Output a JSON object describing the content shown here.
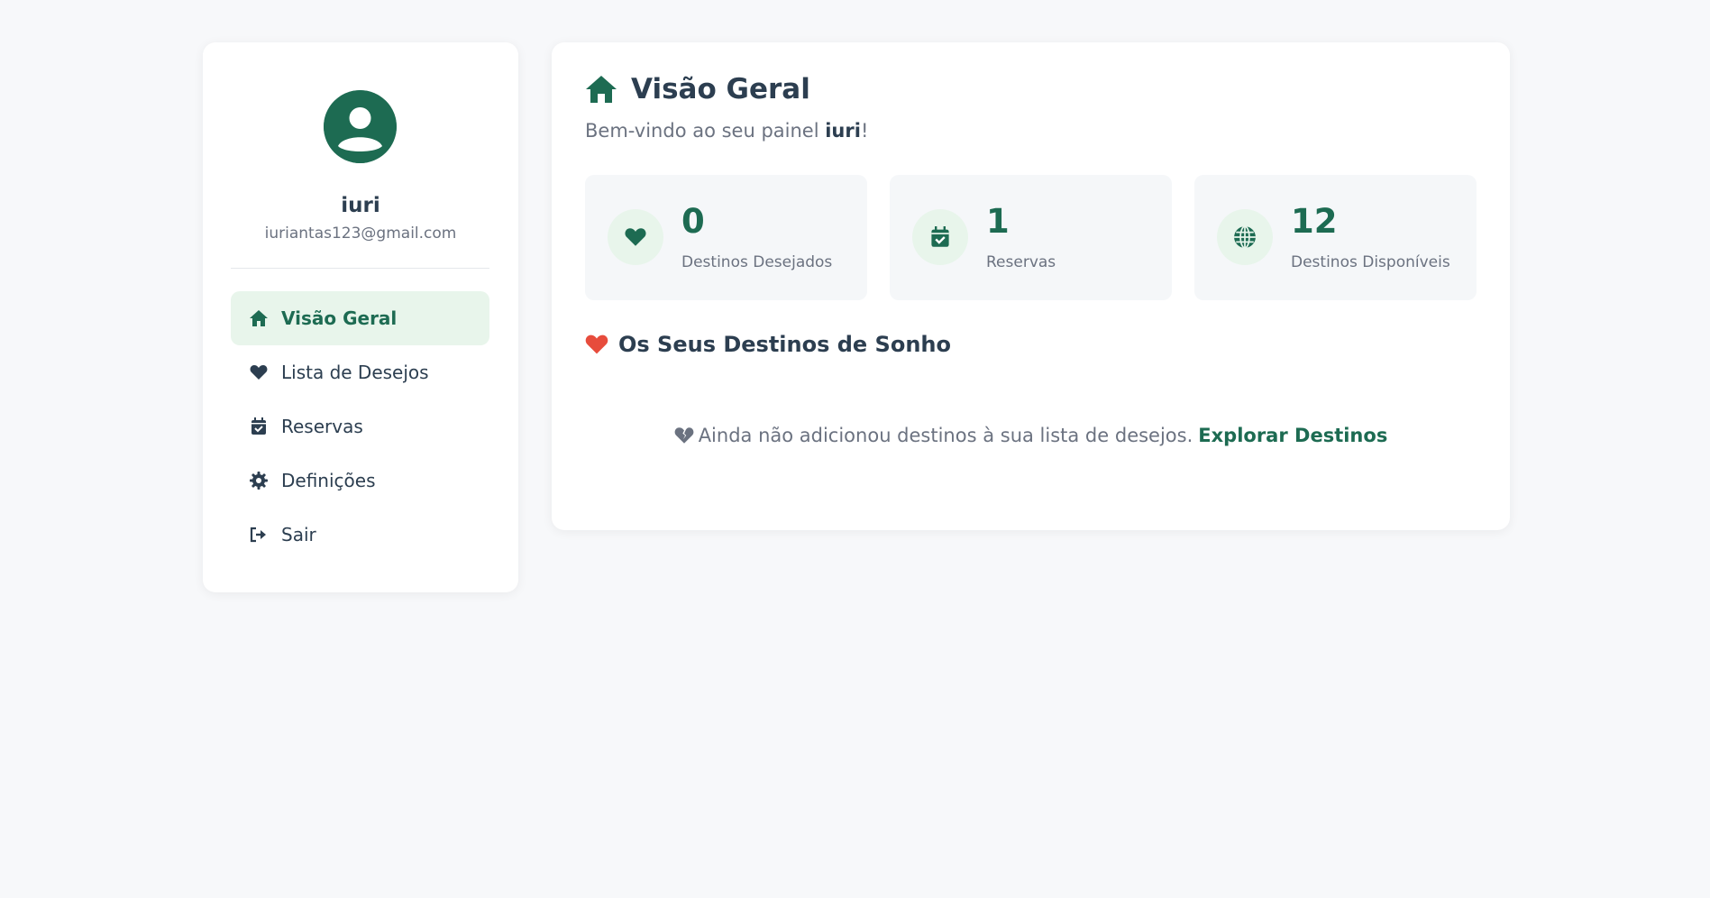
{
  "user": {
    "name": "iuri",
    "email": "iuriantas123@gmail.com"
  },
  "sidebar": {
    "items": [
      {
        "label": "Visão Geral",
        "icon": "home-icon",
        "active": true
      },
      {
        "label": "Lista de Desejos",
        "icon": "heart-icon"
      },
      {
        "label": "Reservas",
        "icon": "calendar-check-icon"
      },
      {
        "label": "Definições",
        "icon": "gear-icon"
      },
      {
        "label": "Sair",
        "icon": "logout-icon"
      }
    ]
  },
  "main": {
    "title": "Visão Geral",
    "welcome_prefix": "Bem-vindo ao seu painel ",
    "welcome_name": "iuri",
    "welcome_suffix": "!",
    "stats": [
      {
        "value": "0",
        "label": "Destinos Desejados",
        "icon": "heart-icon"
      },
      {
        "value": "1",
        "label": "Reservas",
        "icon": "calendar-check-icon"
      },
      {
        "value": "12",
        "label": "Destinos Disponíveis",
        "icon": "globe-icon"
      }
    ],
    "section_title": "Os Seus Destinos de Sonho",
    "empty_text": "Ainda não adicionou destinos à sua lista de desejos.",
    "explore_link": "Explorar Destinos"
  },
  "colors": {
    "accent": "#1d6b52",
    "accent_light": "#e8f5eb",
    "heart_red": "#e74c3c",
    "background": "#f7f8fa",
    "text_dark": "#2c3e50",
    "text_muted": "#6b7280"
  }
}
